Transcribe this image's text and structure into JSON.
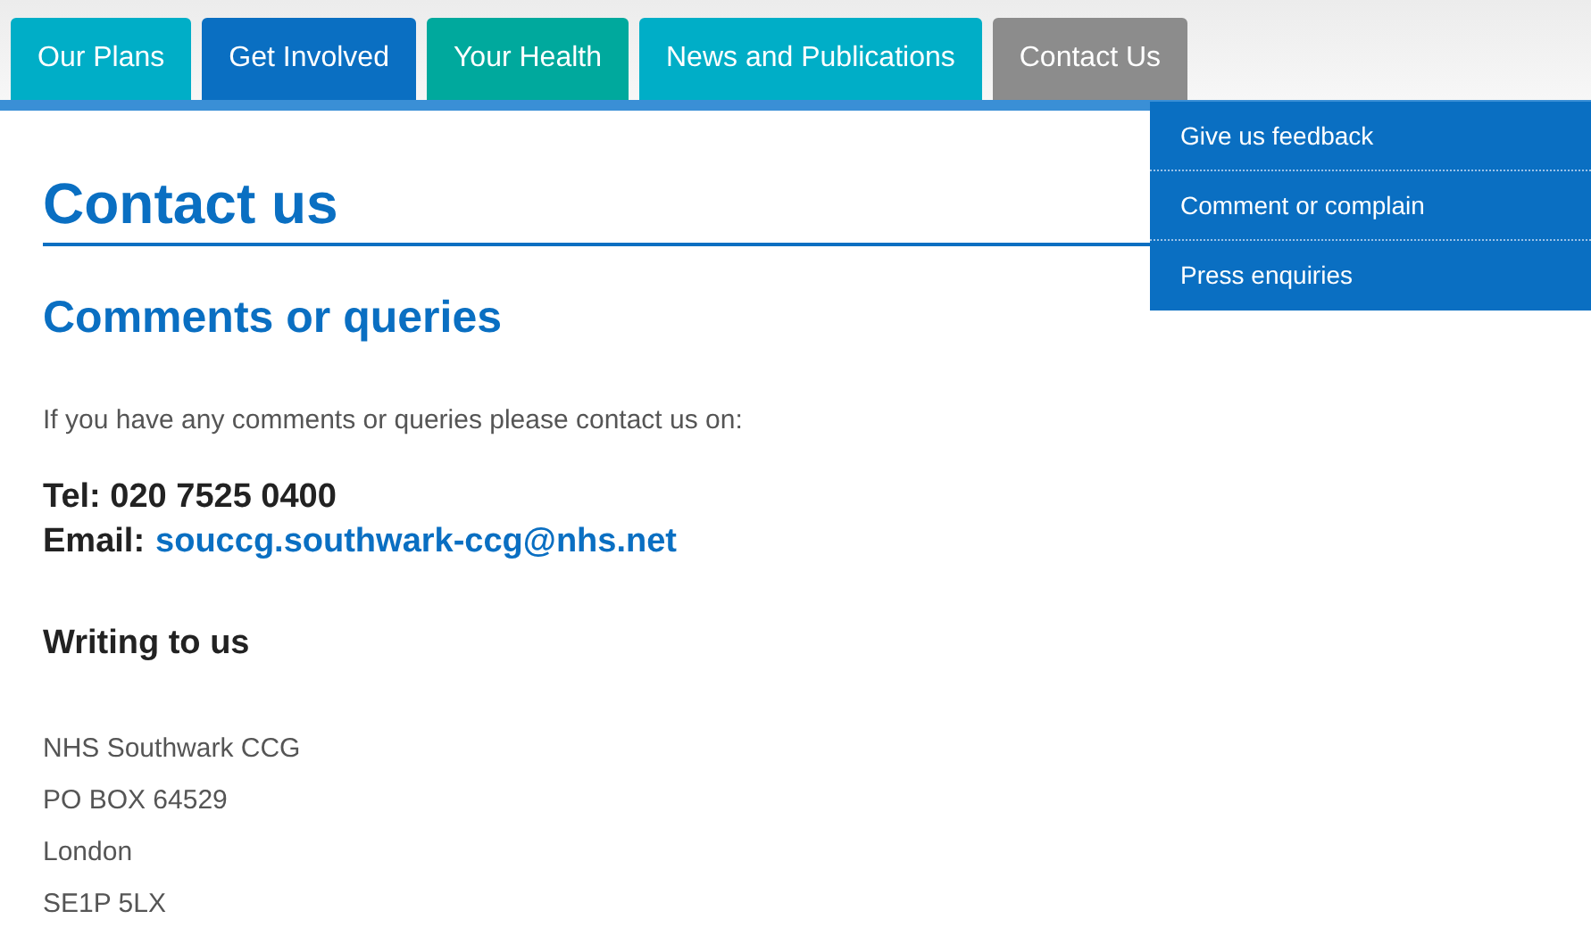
{
  "nav_tabs": [
    {
      "label": "Our Plans",
      "color": "#00aec7",
      "selected": false
    },
    {
      "label": "Get Involved",
      "color": "#0a6fc2",
      "selected": false
    },
    {
      "label": "Your Health",
      "color": "#00a99d",
      "selected": false
    },
    {
      "label": "News and Publications",
      "color": "#00aec7",
      "selected": false
    },
    {
      "label": "Contact Us",
      "selected": true
    }
  ],
  "dropdown_menu": [
    "Give us feedback",
    "Comment or complain",
    "Press enquiries"
  ],
  "page_title": "Contact us",
  "section_heading": "Comments or queries",
  "intro": "If you have any comments or queries please contact us on:",
  "tel": "Tel: 020 7525 0400",
  "email": {
    "label": "Email:",
    "address": "souccg.southwark-ccg@nhs.net"
  },
  "writing_heading": "Writing to us",
  "address_lines": [
    "NHS Southwark CCG",
    "PO BOX 64529",
    "London",
    "SE1P 5LX"
  ]
}
